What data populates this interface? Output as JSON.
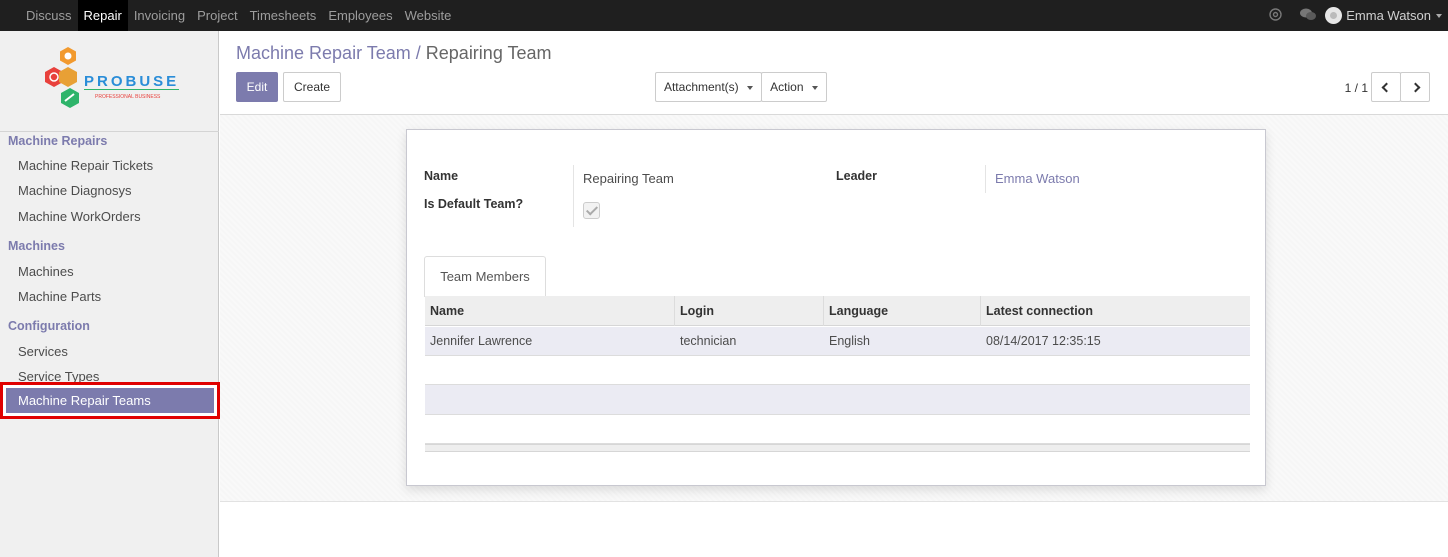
{
  "topbar": {
    "menu": [
      "Discuss",
      "Repair",
      "Invoicing",
      "Project",
      "Timesheets",
      "Employees",
      "Website"
    ],
    "active": "Repair",
    "user": "Emma Watson",
    "icons": [
      "at-icon",
      "chat-icon"
    ]
  },
  "logo": {
    "name": "PROBUSE",
    "tagline": "PROFESSIONAL BUSINESS"
  },
  "sidebar": {
    "sections": [
      {
        "title": "Machine Repairs",
        "items": [
          "Machine Repair Tickets",
          "Machine Diagnosys",
          "Machine WorkOrders"
        ]
      },
      {
        "title": "Machines",
        "items": [
          "Machines",
          "Machine Parts"
        ]
      },
      {
        "title": "Configuration",
        "items": [
          "Services",
          "Service Types",
          "Machine Repair Teams"
        ]
      }
    ],
    "active_item": "Machine Repair Teams"
  },
  "control_panel": {
    "breadcrumb_parent": "Machine Repair Team /",
    "breadcrumb_current": "Repairing Team",
    "edit_label": "Edit",
    "create_label": "Create",
    "attachments_label": "Attachment(s)",
    "action_label": "Action",
    "pager": "1 / 1"
  },
  "form": {
    "name_label": "Name",
    "name_value": "Repairing Team",
    "default_label": "Is Default Team?",
    "is_default": true,
    "leader_label": "Leader",
    "leader_value": "Emma Watson",
    "tab_label": "Team Members",
    "columns": [
      "Name",
      "Login",
      "Language",
      "Latest connection"
    ],
    "rows": [
      [
        "Jennifer Lawrence",
        "technician",
        "English",
        "08/14/2017 12:35:15"
      ]
    ]
  },
  "colors": {
    "accent": "#7c7bad",
    "topbar": "#1f1f1f",
    "highlight": "#e00000"
  }
}
